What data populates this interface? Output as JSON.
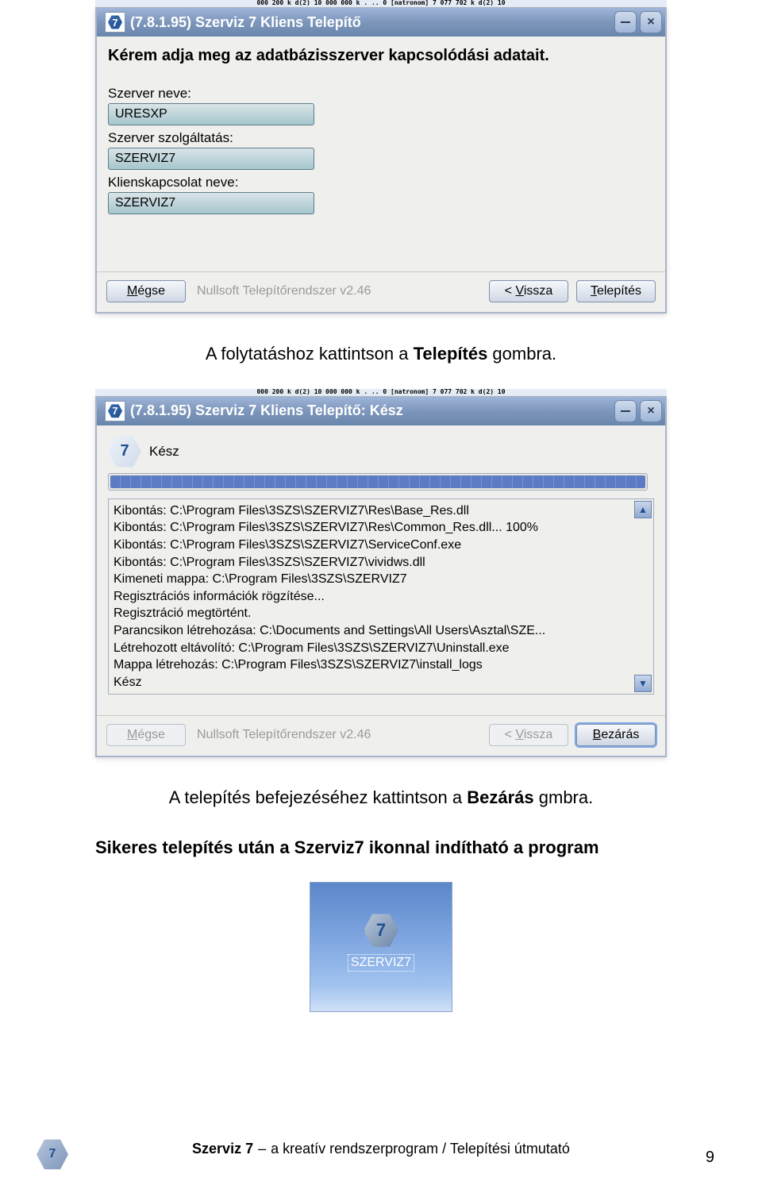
{
  "bg_crop_text": "000 200 k d(2) 10 000 000 k     .    ..      0    [natronom] 7 077 702 k d(2) 10",
  "installer1": {
    "title": "(7.8.1.95) Szerviz 7 Kliens Telepítő",
    "prompt": "Kérem adja meg az adatbázisszerver kapcsolódási adatait.",
    "fields": [
      {
        "label": "Szerver neve:",
        "value": "URESXP"
      },
      {
        "label": "Szerver szolgáltatás:",
        "value": "SZERVIZ7"
      },
      {
        "label": "Klienskapcsolat neve:",
        "value": "SZERVIZ7"
      }
    ],
    "cancel": "Mégse",
    "note": "Nullsoft Telepítőrendszer v2.46",
    "back": "< Vissza",
    "install": "Telepítés"
  },
  "caption1_a": "A folytatáshoz kattintson a ",
  "caption1_b": "Telepítés",
  "caption1_c": " gombra.",
  "installer2": {
    "title": "(7.8.1.95) Szerviz 7 Kliens Telepítő: Kész",
    "status": "Kész",
    "log": [
      "Kibontás: C:\\Program Files\\3SZS\\SZERVIZ7\\Res\\Base_Res.dll",
      "Kibontás: C:\\Program Files\\3SZS\\SZERVIZ7\\Res\\Common_Res.dll... 100%",
      "Kibontás: C:\\Program Files\\3SZS\\SZERVIZ7\\ServiceConf.exe",
      "Kibontás: C:\\Program Files\\3SZS\\SZERVIZ7\\vividws.dll",
      "Kimeneti mappa: C:\\Program Files\\3SZS\\SZERVIZ7",
      "Regisztrációs információk rögzítése...",
      "Regisztráció megtörtént.",
      "Parancsikon létrehozása: C:\\Documents and Settings\\All Users\\Asztal\\SZE...",
      "Létrehozott eltávolító: C:\\Program Files\\3SZS\\SZERVIZ7\\Uninstall.exe",
      "Mappa létrehozás: C:\\Program Files\\3SZS\\SZERVIZ7\\install_logs",
      "Kész"
    ],
    "cancel": "Mégse",
    "note": "Nullsoft Telepítőrendszer v2.46",
    "back": "< Vissza",
    "close": "Bezárás"
  },
  "caption2_a": "A telepítés befejezéséhez kattintson a  ",
  "caption2_b": "Bezárás",
  "caption2_c": " gmbra.",
  "final_note": "Sikeres telepítés után a Szerviz7 ikonnal indítható a program",
  "desktop_label": "SZERVIZ7",
  "footer_bold": "Szerviz 7",
  "footer_dash": " – ",
  "footer_text": "a kreatív rendszerprogram / Telepítési útmutató",
  "pagenum": "9"
}
